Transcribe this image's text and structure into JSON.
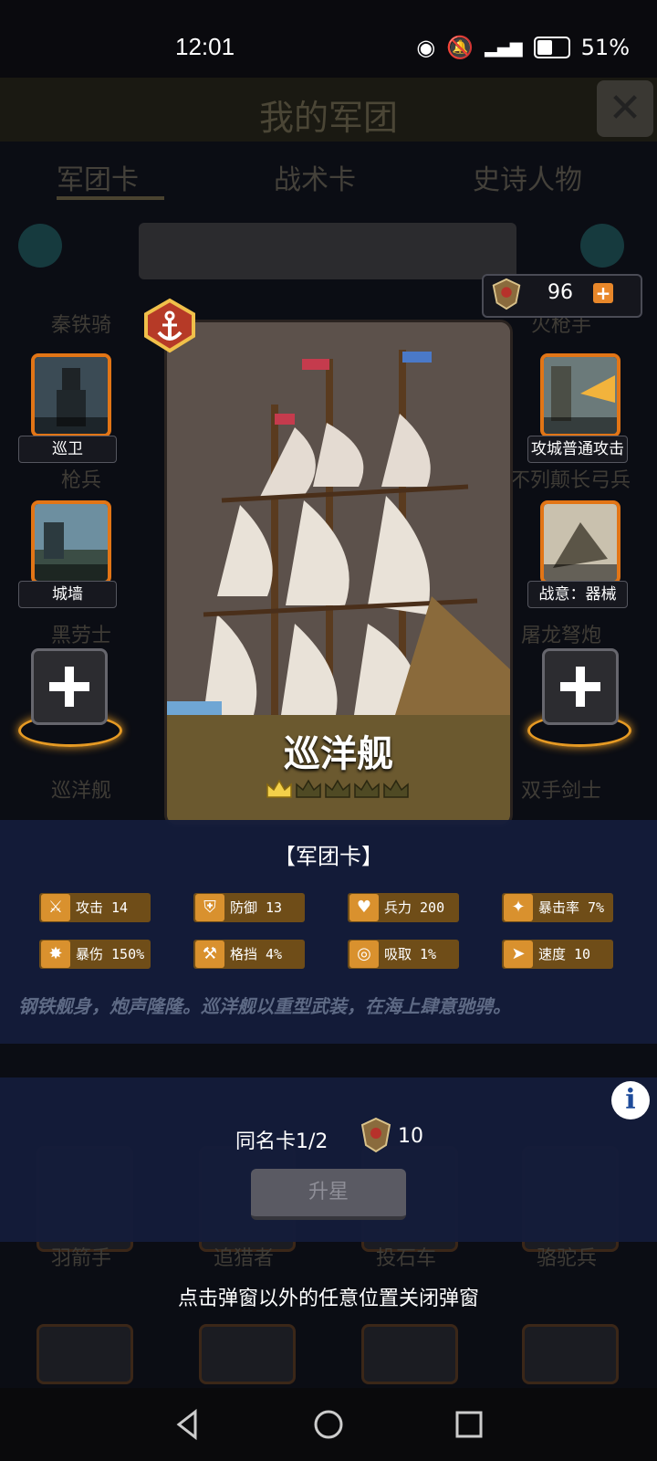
{
  "status_bar": {
    "time": "12:01",
    "battery": "51%"
  },
  "background": {
    "title": "我的军团",
    "tabs": [
      "军团卡",
      "战术卡",
      "史诗人物"
    ],
    "grid_names": [
      "秦铁骑",
      "火枪手",
      "枪兵",
      "不列颠长弓兵",
      "黑劳士",
      "屠龙弩炮",
      "巡洋舰",
      "双手剑士",
      "羽箭手",
      "追猎者",
      "投石车",
      "骆驼兵"
    ]
  },
  "currency": {
    "value": "96",
    "icon": "crest-icon"
  },
  "card": {
    "name": "巡洋舰",
    "stars": 1,
    "max_stars": 5,
    "badge_icon": "anchor-icon"
  },
  "slots": {
    "left": [
      {
        "label": "巡卫"
      },
      {
        "label": "城墙"
      }
    ],
    "right": [
      {
        "label": "攻城普通攻击"
      },
      {
        "label": "战意：器械"
      }
    ]
  },
  "panel": {
    "title": "【军团卡】",
    "stats": [
      {
        "icon": "sword-icon",
        "text": "攻击 14"
      },
      {
        "icon": "shield-icon",
        "text": "防御 13"
      },
      {
        "icon": "heart-icon",
        "text": "兵力 200"
      },
      {
        "icon": "crit-icon",
        "text": "暴击率 7%"
      },
      {
        "icon": "burst-icon",
        "text": "暴伤 150%"
      },
      {
        "icon": "block-icon",
        "text": "格挡 4%"
      },
      {
        "icon": "drain-icon",
        "text": "吸取 1%"
      },
      {
        "icon": "boot-icon",
        "text": "速度 10"
      }
    ],
    "description": "钢铁舰身，炮声隆隆。巡洋舰以重型武装，在海上肆意驰骋。"
  },
  "upgrade": {
    "same_card_text": "同名卡1/2",
    "cost": "10",
    "button_label": "升星"
  },
  "close_hint": "点击弹窗以外的任意位置关闭弹窗"
}
